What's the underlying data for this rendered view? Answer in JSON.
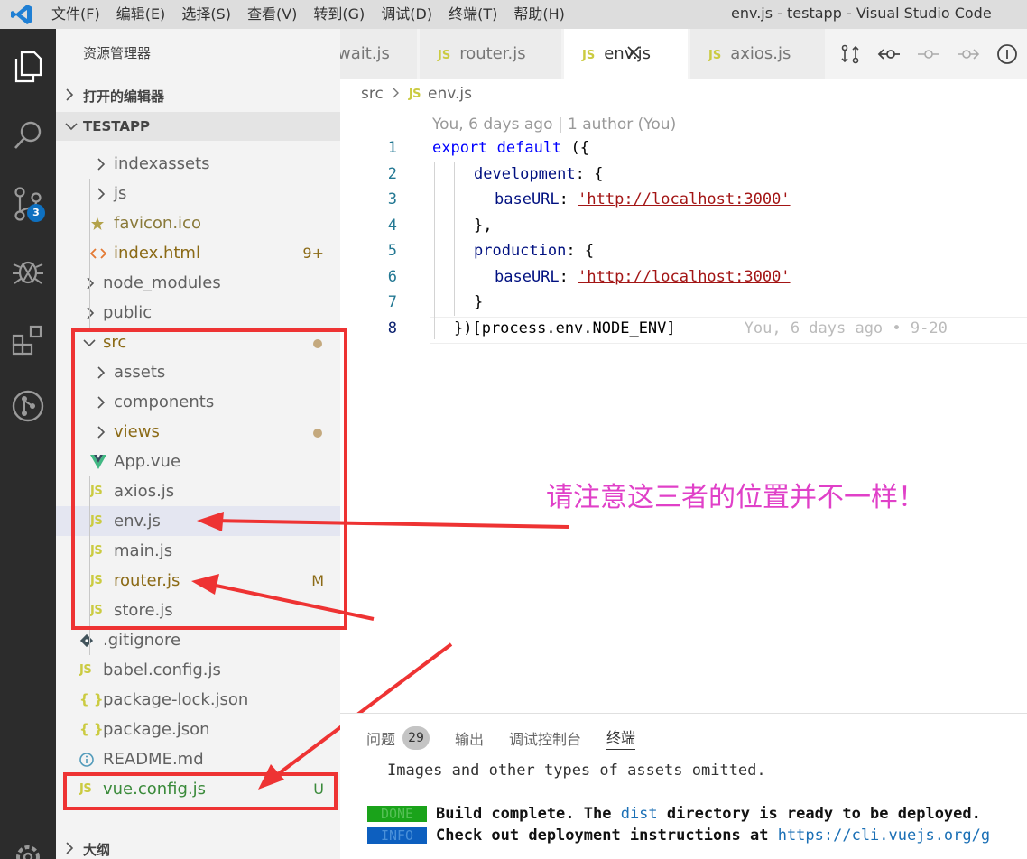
{
  "window": {
    "title": "env.js - testapp - Visual Studio Code",
    "menu": [
      "文件(F)",
      "编辑(E)",
      "选择(S)",
      "查看(V)",
      "转到(G)",
      "调试(D)",
      "终端(T)",
      "帮助(H)"
    ]
  },
  "activity_bar": {
    "items": [
      "explorer-icon",
      "search-icon",
      "source-control-icon",
      "debug-icon",
      "extensions-icon",
      "git-graph-icon",
      "settings-gear-icon"
    ],
    "scm_badge": "3"
  },
  "sidebar": {
    "title": "资源管理器",
    "open_editors_label": "打开的编辑器",
    "project_label": "TESTAPP",
    "outline_label": "大纲",
    "rows": [
      {
        "label": "indexassets",
        "kind": "folder",
        "color": "#616161"
      },
      {
        "label": "js",
        "kind": "folder",
        "color": "#616161"
      },
      {
        "label": "favicon.ico",
        "kind": "star",
        "color": "#8a7a3a"
      },
      {
        "label": "index.html",
        "kind": "html",
        "color": "#8b6a16",
        "decoration": "9+"
      },
      {
        "label": "node_modules",
        "kind": "folder",
        "color": "#616161"
      },
      {
        "label": "public",
        "kind": "folder",
        "color": "#616161"
      },
      {
        "label": "src",
        "kind": "folder-open",
        "color": "#8b6a16",
        "dot": true
      },
      {
        "label": "assets",
        "kind": "folder",
        "color": "#616161"
      },
      {
        "label": "components",
        "kind": "folder",
        "color": "#616161"
      },
      {
        "label": "views",
        "kind": "folder",
        "color": "#8b6a16",
        "dot": true
      },
      {
        "label": "App.vue",
        "kind": "vue",
        "color": "#616161"
      },
      {
        "label": "axios.js",
        "kind": "js",
        "color": "#616161"
      },
      {
        "label": "env.js",
        "kind": "js",
        "color": "#616161",
        "selected": true
      },
      {
        "label": "main.js",
        "kind": "js",
        "color": "#616161"
      },
      {
        "label": "router.js",
        "kind": "js",
        "color": "#8b6a16",
        "decoration": "M"
      },
      {
        "label": "store.js",
        "kind": "js",
        "color": "#616161"
      },
      {
        "label": ".gitignore",
        "kind": "git",
        "color": "#616161"
      },
      {
        "label": "babel.config.js",
        "kind": "js",
        "color": "#616161"
      },
      {
        "label": "package-lock.json",
        "kind": "json",
        "color": "#616161"
      },
      {
        "label": "package.json",
        "kind": "json",
        "color": "#616161"
      },
      {
        "label": "README.md",
        "kind": "info",
        "color": "#616161"
      },
      {
        "label": "vue.config.js",
        "kind": "js",
        "color": "#3a8a3a",
        "decoration": "U"
      }
    ]
  },
  "tabs": [
    {
      "label": "wait.js",
      "active": false,
      "js": false
    },
    {
      "label": "router.js",
      "active": false,
      "js": true
    },
    {
      "label": "env.js",
      "active": true,
      "js": true
    },
    {
      "label": "axios.js",
      "active": false,
      "js": true
    }
  ],
  "js_badge": "JS",
  "editor": {
    "breadcrumb": [
      "src",
      "env.js"
    ],
    "codelens": "You, 6 days ago | 1 author (You)",
    "line_numbers": [
      "1",
      "2",
      "3",
      "4",
      "5",
      "6",
      "7",
      "8"
    ],
    "code": {
      "l1_kw": "export default",
      "l1_rest": " ({",
      "l2_prop": "development",
      "l2_rest": ": {",
      "l3_prop": "baseURL",
      "l3_colon": ": ",
      "l3_str": "'http://localhost:3000'",
      "l4": "},",
      "l5_prop": "production",
      "l5_rest": ": {",
      "l6_prop": "baseURL",
      "l6_colon": ": ",
      "l6_str": "'http://localhost:3000'",
      "l7": "}",
      "l8_code": "})[process.env.NODE_ENV]",
      "l8_blame": "You, 6 days ago • 9-20"
    }
  },
  "annotation": {
    "text": "请注意这三者的位置并不一样！",
    "color": "#e040c8"
  },
  "panel": {
    "tabs": [
      "问题",
      "输出",
      "调试控制台",
      "终端"
    ],
    "problems_count": "29",
    "active_tab": "终端",
    "line1": "Images and other types of assets omitted.",
    "done_tag": "DONE",
    "done_text_pre": "Build complete. The ",
    "done_text_dist": "dist",
    "done_text_post": " directory is ready to be deployed.",
    "info_tag": "INFO",
    "info_text": "Check out deployment instructions at ",
    "info_link": "https://cli.vuejs.org/g"
  }
}
